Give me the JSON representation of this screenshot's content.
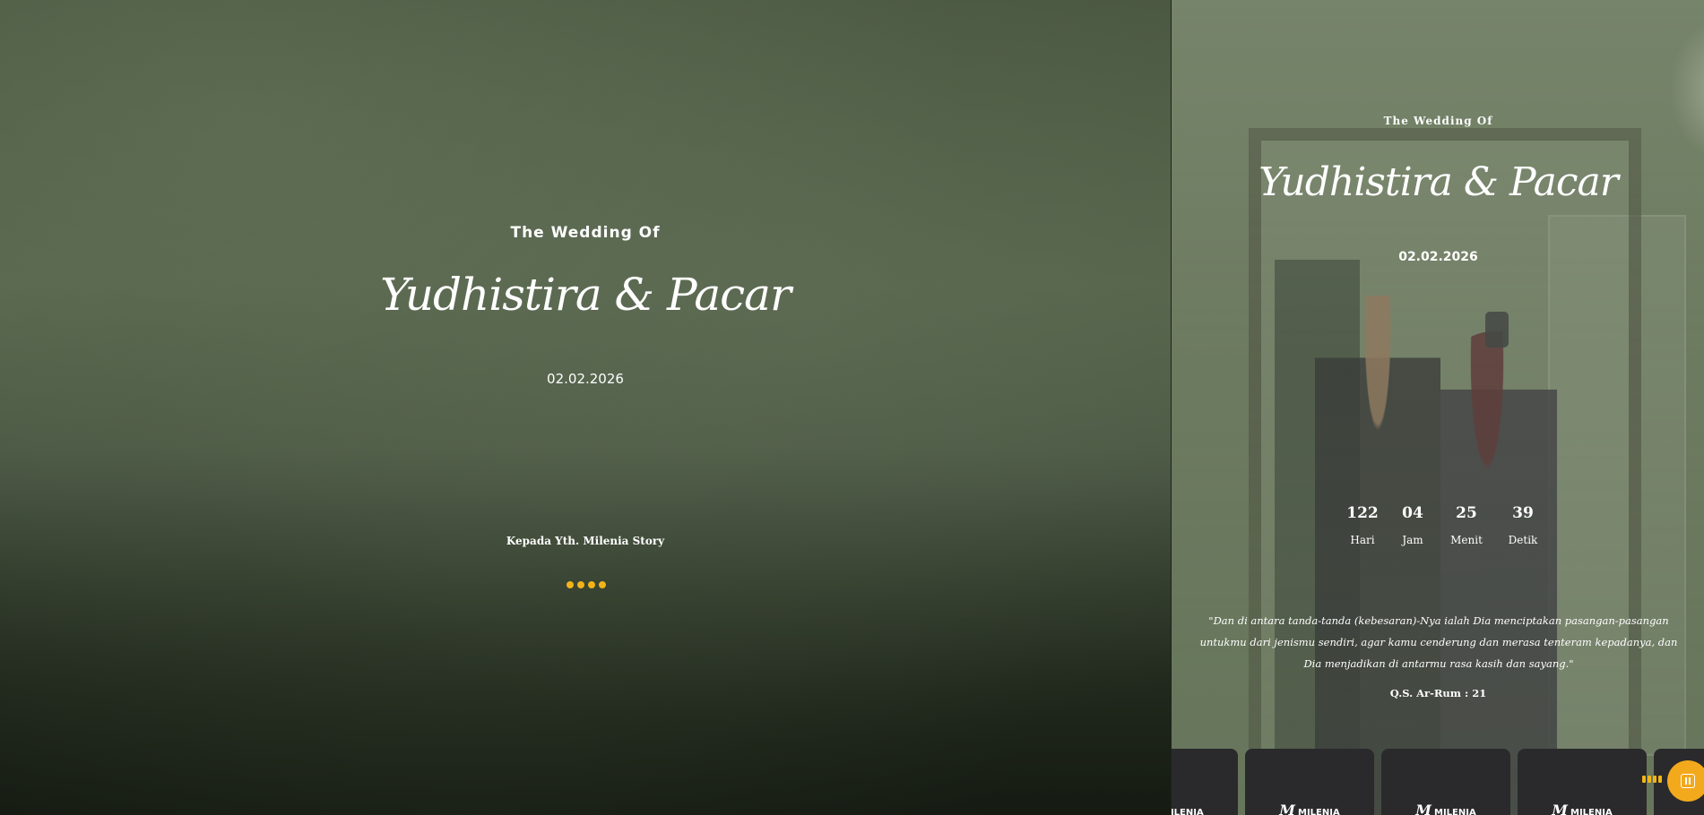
{
  "cover": {
    "subtitle": "The Wedding Of",
    "names": "Yudhistira & Pacar",
    "date": "02.02.2026",
    "guest_line": "Kepada Yth. Milenia Story"
  },
  "hero": {
    "subtitle": "The Wedding Of",
    "names": "Yudhistira & Pacar",
    "date": "02.02.2026"
  },
  "countdown": [
    {
      "value": "122",
      "label": "Hari"
    },
    {
      "value": "04",
      "label": "Jam"
    },
    {
      "value": "25",
      "label": "Menit"
    },
    {
      "value": "39",
      "label": "Detik"
    }
  ],
  "quote": {
    "text": "\"Dan di antara tanda-tanda (kebesaran)-Nya ialah Dia menciptakan pasangan-pasangan untukmu dari jenismu sendiri, agar kamu cenderung dan merasa tenteram kepadanya, dan Dia menjadikan di antarmu rasa kasih dan sayang.\"",
    "source": "Q.S. Ar-Rum : 21"
  },
  "cards": [
    {
      "brand": "MILENIA"
    },
    {
      "brand": "MILENIA"
    },
    {
      "brand": "MILENIA"
    },
    {
      "brand": "MILENIA"
    }
  ],
  "colors": {
    "accent": "#f2b418",
    "music_button": "#f2a91c",
    "card_bg": "#2a2a2c"
  },
  "icons": {
    "loader": "dots-loader-icon",
    "music": "pause-music-icon"
  }
}
